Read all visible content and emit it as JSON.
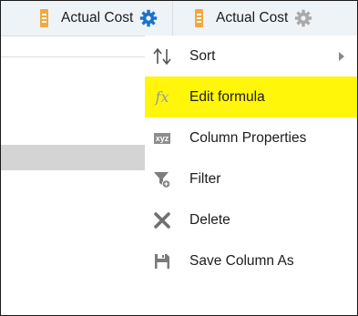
{
  "columns": [
    {
      "title": "Actual Cost",
      "icon": "measure-icon",
      "gear_color": "#1a73c7"
    },
    {
      "title": "Actual Cost",
      "icon": "measure-icon",
      "gear_color": "#a9a9a9"
    }
  ],
  "menu": {
    "items": [
      {
        "label": "Sort",
        "icon": "sort-icon",
        "has_submenu": true
      },
      {
        "label": "Edit formula",
        "icon": "formula-icon",
        "icon_text": "fx",
        "highlighted": true
      },
      {
        "label": "Column Properties",
        "icon": "column-properties-icon",
        "icon_text": "xyz"
      },
      {
        "label": "Filter",
        "icon": "filter-icon"
      },
      {
        "label": "Delete",
        "icon": "delete-icon"
      },
      {
        "label": "Save Column As",
        "icon": "save-icon"
      }
    ]
  },
  "colors": {
    "highlight": "#fff60a",
    "measure_icon": "#f2a93b",
    "header_bg": "#eef3f8"
  }
}
